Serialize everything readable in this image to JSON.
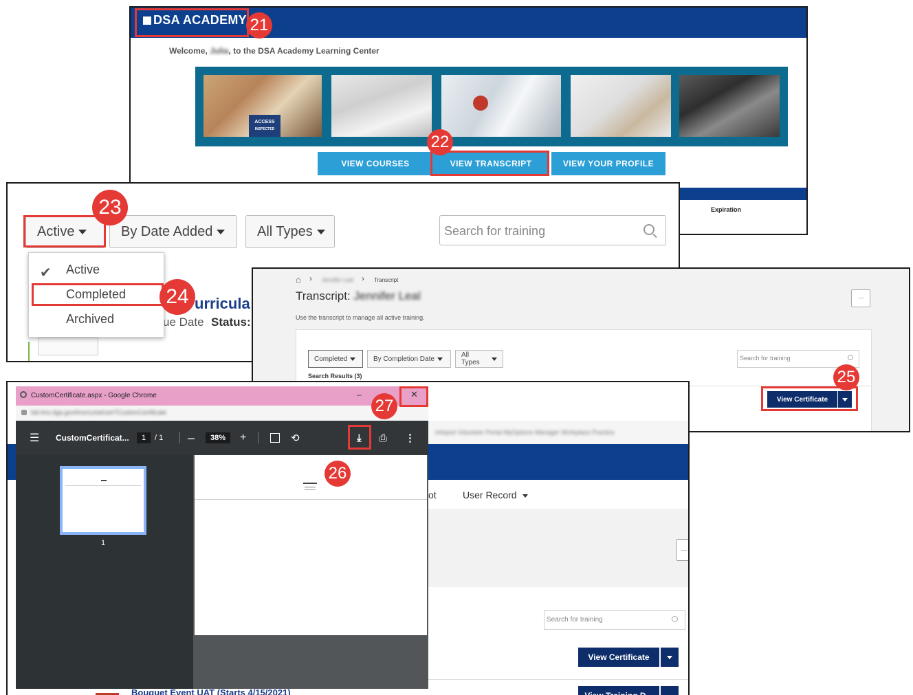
{
  "callouts": {
    "c21": "21",
    "c22": "22",
    "c23": "23",
    "c24": "24",
    "c25": "25",
    "c26": "26",
    "c27": "27"
  },
  "panel1": {
    "logo_text": "DSA ACADEMY",
    "welcome_prefix": "Welcome,",
    "welcome_name": "Julia",
    "welcome_suffix": ", to the DSA Academy Learning Center",
    "photo_badge": "ACCESS",
    "photo_badge_sub": "INSPECTED",
    "buttons": {
      "courses": "VIEW COURSES",
      "transcript": "VIEW TRANSCRIPT",
      "profile": "VIEW YOUR PROFILE"
    },
    "table_header": "Expiration",
    "brand_color": "#0d3f8f"
  },
  "panel2": {
    "filters": {
      "status": "Active",
      "sort": "By Date Added",
      "types": "All Types"
    },
    "search_placeholder": "Search for training",
    "menu": {
      "active": "Active",
      "completed": "Completed",
      "archived": "Archived"
    },
    "bg_title": "urricula",
    "bg_due": "ue Date",
    "bg_status": "Status:"
  },
  "panel3": {
    "breadcrumb_mid": "Jennifer Leal",
    "breadcrumb_current": "Transcript",
    "title_prefix": "Transcript:",
    "title_name": "Jennifer Leal",
    "subtitle": "Use the transcript to manage all active training.",
    "more_button": "···",
    "filters": {
      "status": "Completed",
      "sort": "By Completion Date",
      "types": "All Types"
    },
    "search_placeholder": "Search for training",
    "results": "Search Results (3)",
    "view_certificate": "View Certificate"
  },
  "panel4": {
    "window_title": "CustomCertificate.aspx - Google Chrome",
    "minimize": "–",
    "close": "✕",
    "url_blurred": "lstt-lms.dga.gov/lms/cu/wt/cert?CustomCertificate",
    "doc_title": "CustomCertificat...",
    "page_current": "1",
    "page_total": "/ 1",
    "zoom": "38%",
    "thumb_page": "1",
    "bg_nav_item1": "ot",
    "bg_nav_item2": "User Record",
    "bg_more": "···",
    "bg_search_placeholder": "Search for training",
    "bg_view_certificate": "View Certificate",
    "bg_view_training": "View Training D...",
    "bg_event_title": "Bouquet Event UAT (Starts 4/15/2021)",
    "blurred_bookmarks": "Infoport     Volunteer Portal     MyOptions Manager     Workplace Practice"
  }
}
